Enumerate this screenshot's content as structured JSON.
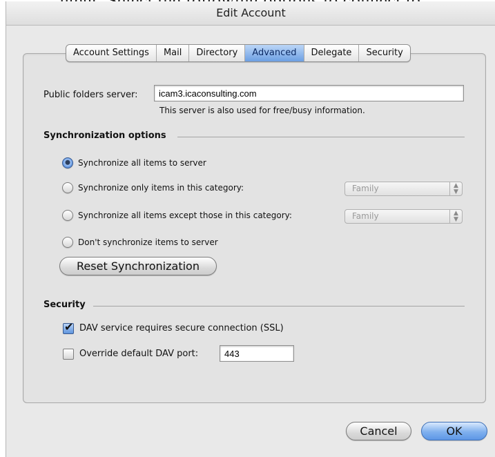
{
  "backdrop_text": "ntent. Select the following options to connect to...",
  "window": {
    "title": "Edit Account"
  },
  "tabs": [
    {
      "label": "Account Settings"
    },
    {
      "label": "Mail"
    },
    {
      "label": "Directory"
    },
    {
      "label": "Advanced"
    },
    {
      "label": "Delegate"
    },
    {
      "label": "Security"
    }
  ],
  "active_tab": "Advanced",
  "public_folders": {
    "label": "Public folders server:",
    "value": "icam3.icaconsulting.com",
    "note": "This server is also used for free/busy information."
  },
  "sync": {
    "heading": "Synchronization options",
    "options": [
      {
        "label": "Synchronize all items to server",
        "selected": true
      },
      {
        "label": "Synchronize only items in this category:",
        "selected": false,
        "category": "Family"
      },
      {
        "label": "Synchronize all items except those in this category:",
        "selected": false,
        "category": "Family"
      },
      {
        "label": "Don't synchronize items to server",
        "selected": false
      }
    ],
    "reset_button": "Reset Synchronization"
  },
  "security": {
    "heading": "Security",
    "ssl_label": "DAV service requires secure connection (SSL)",
    "ssl_checked": true,
    "override_label": "Override default DAV port:",
    "override_checked": false,
    "port_value": "443"
  },
  "buttons": {
    "cancel": "Cancel",
    "ok": "OK"
  },
  "colors": {
    "accent": "#6c9fe3",
    "panel": "#e3e3e3",
    "window": "#e9e9e9"
  }
}
